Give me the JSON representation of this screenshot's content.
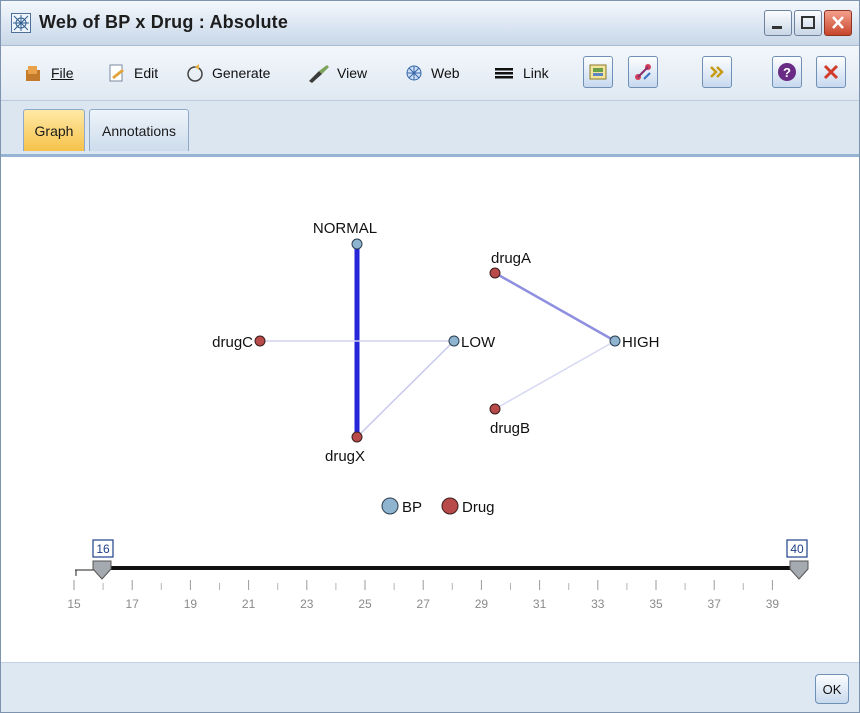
{
  "window": {
    "title": "Web of BP x Drug : Absolute"
  },
  "menu": {
    "items": [
      {
        "label": "File",
        "icon": "file-icon"
      },
      {
        "label": "Edit",
        "icon": "edit-icon"
      },
      {
        "label": "Generate",
        "icon": "generate-icon"
      },
      {
        "label": "View",
        "icon": "view-icon"
      },
      {
        "label": "Web",
        "icon": "web-icon"
      },
      {
        "label": "Link",
        "icon": "link-icon"
      }
    ]
  },
  "toolbar": {
    "buttons": [
      "export-icon",
      "web-layout-icon",
      "expand-icon",
      "help-icon",
      "close-icon"
    ]
  },
  "tabs": [
    {
      "label": "Graph",
      "active": true
    },
    {
      "label": "Annotations",
      "active": false
    }
  ],
  "graph": {
    "nodes": [
      {
        "label": "NORMAL",
        "group": "BP"
      },
      {
        "label": "LOW",
        "group": "BP"
      },
      {
        "label": "HIGH",
        "group": "BP"
      },
      {
        "label": "drugA",
        "group": "Drug"
      },
      {
        "label": "drugB",
        "group": "Drug"
      },
      {
        "label": "drugC",
        "group": "Drug"
      },
      {
        "label": "drugX",
        "group": "Drug"
      }
    ],
    "links": [
      {
        "from": "NORMAL",
        "to": "drugX",
        "strength": "strong"
      },
      {
        "from": "drugA",
        "to": "HIGH",
        "strength": "medium"
      },
      {
        "from": "drugC",
        "to": "LOW",
        "strength": "weak"
      },
      {
        "from": "LOW",
        "to": "drugX",
        "strength": "weak"
      },
      {
        "from": "drugB",
        "to": "HIGH",
        "strength": "weak"
      }
    ],
    "legend": [
      {
        "label": "BP",
        "color": "#8fb4cf"
      },
      {
        "label": "Drug",
        "color": "#b84a4a"
      }
    ],
    "slider": {
      "min_value": "16",
      "max_value": "40",
      "ticks": [
        "15",
        "17",
        "19",
        "21",
        "23",
        "25",
        "27",
        "29",
        "31",
        "33",
        "35",
        "37",
        "39"
      ]
    }
  },
  "footer": {
    "ok_label": "OK"
  }
}
